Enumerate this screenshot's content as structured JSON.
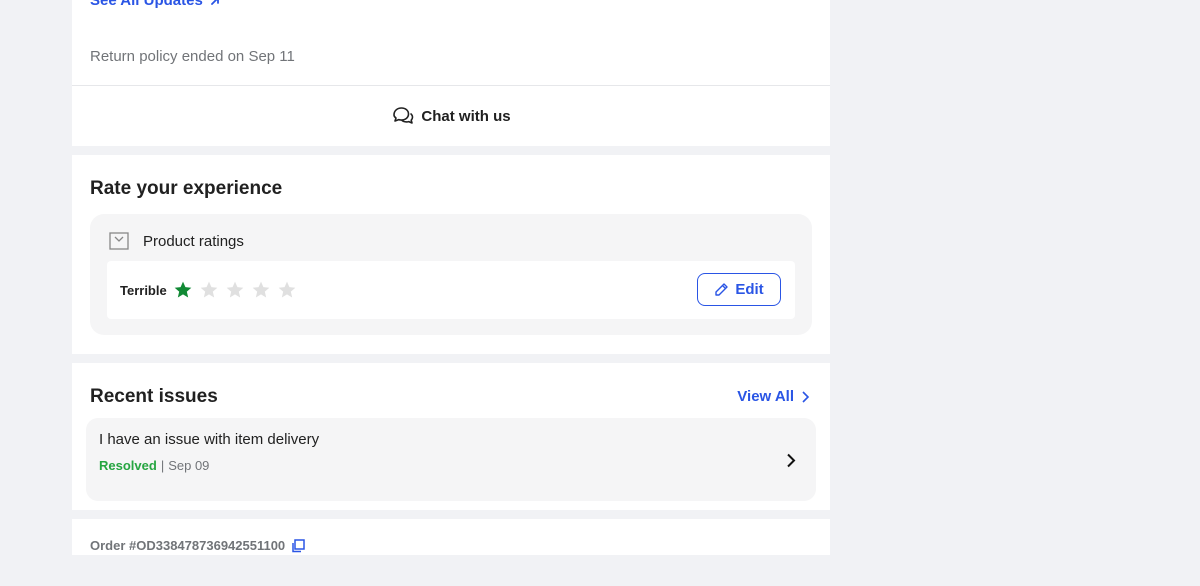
{
  "top": {
    "see_all_updates": "See All Updates",
    "return_policy": "Return policy ended on Sep 11",
    "chat_label": "Chat with us"
  },
  "rate": {
    "title": "Rate your experience",
    "product_ratings_label": "Product ratings",
    "rating_label": "Terrible",
    "rating_value": 1,
    "rating_max": 5,
    "edit_label": "Edit"
  },
  "issues": {
    "title": "Recent issues",
    "view_all": "View All",
    "items": [
      {
        "text": "I have an issue with item delivery",
        "status": "Resolved",
        "separator": "|",
        "date": "Sep 09"
      }
    ]
  },
  "order": {
    "id_text": "Order #OD338478736942551100"
  },
  "colors": {
    "accent": "#2a55e5",
    "resolved": "#26a541",
    "star_filled": "#108934",
    "star_empty": "#e0e0e0",
    "background": "#f1f2f5"
  }
}
